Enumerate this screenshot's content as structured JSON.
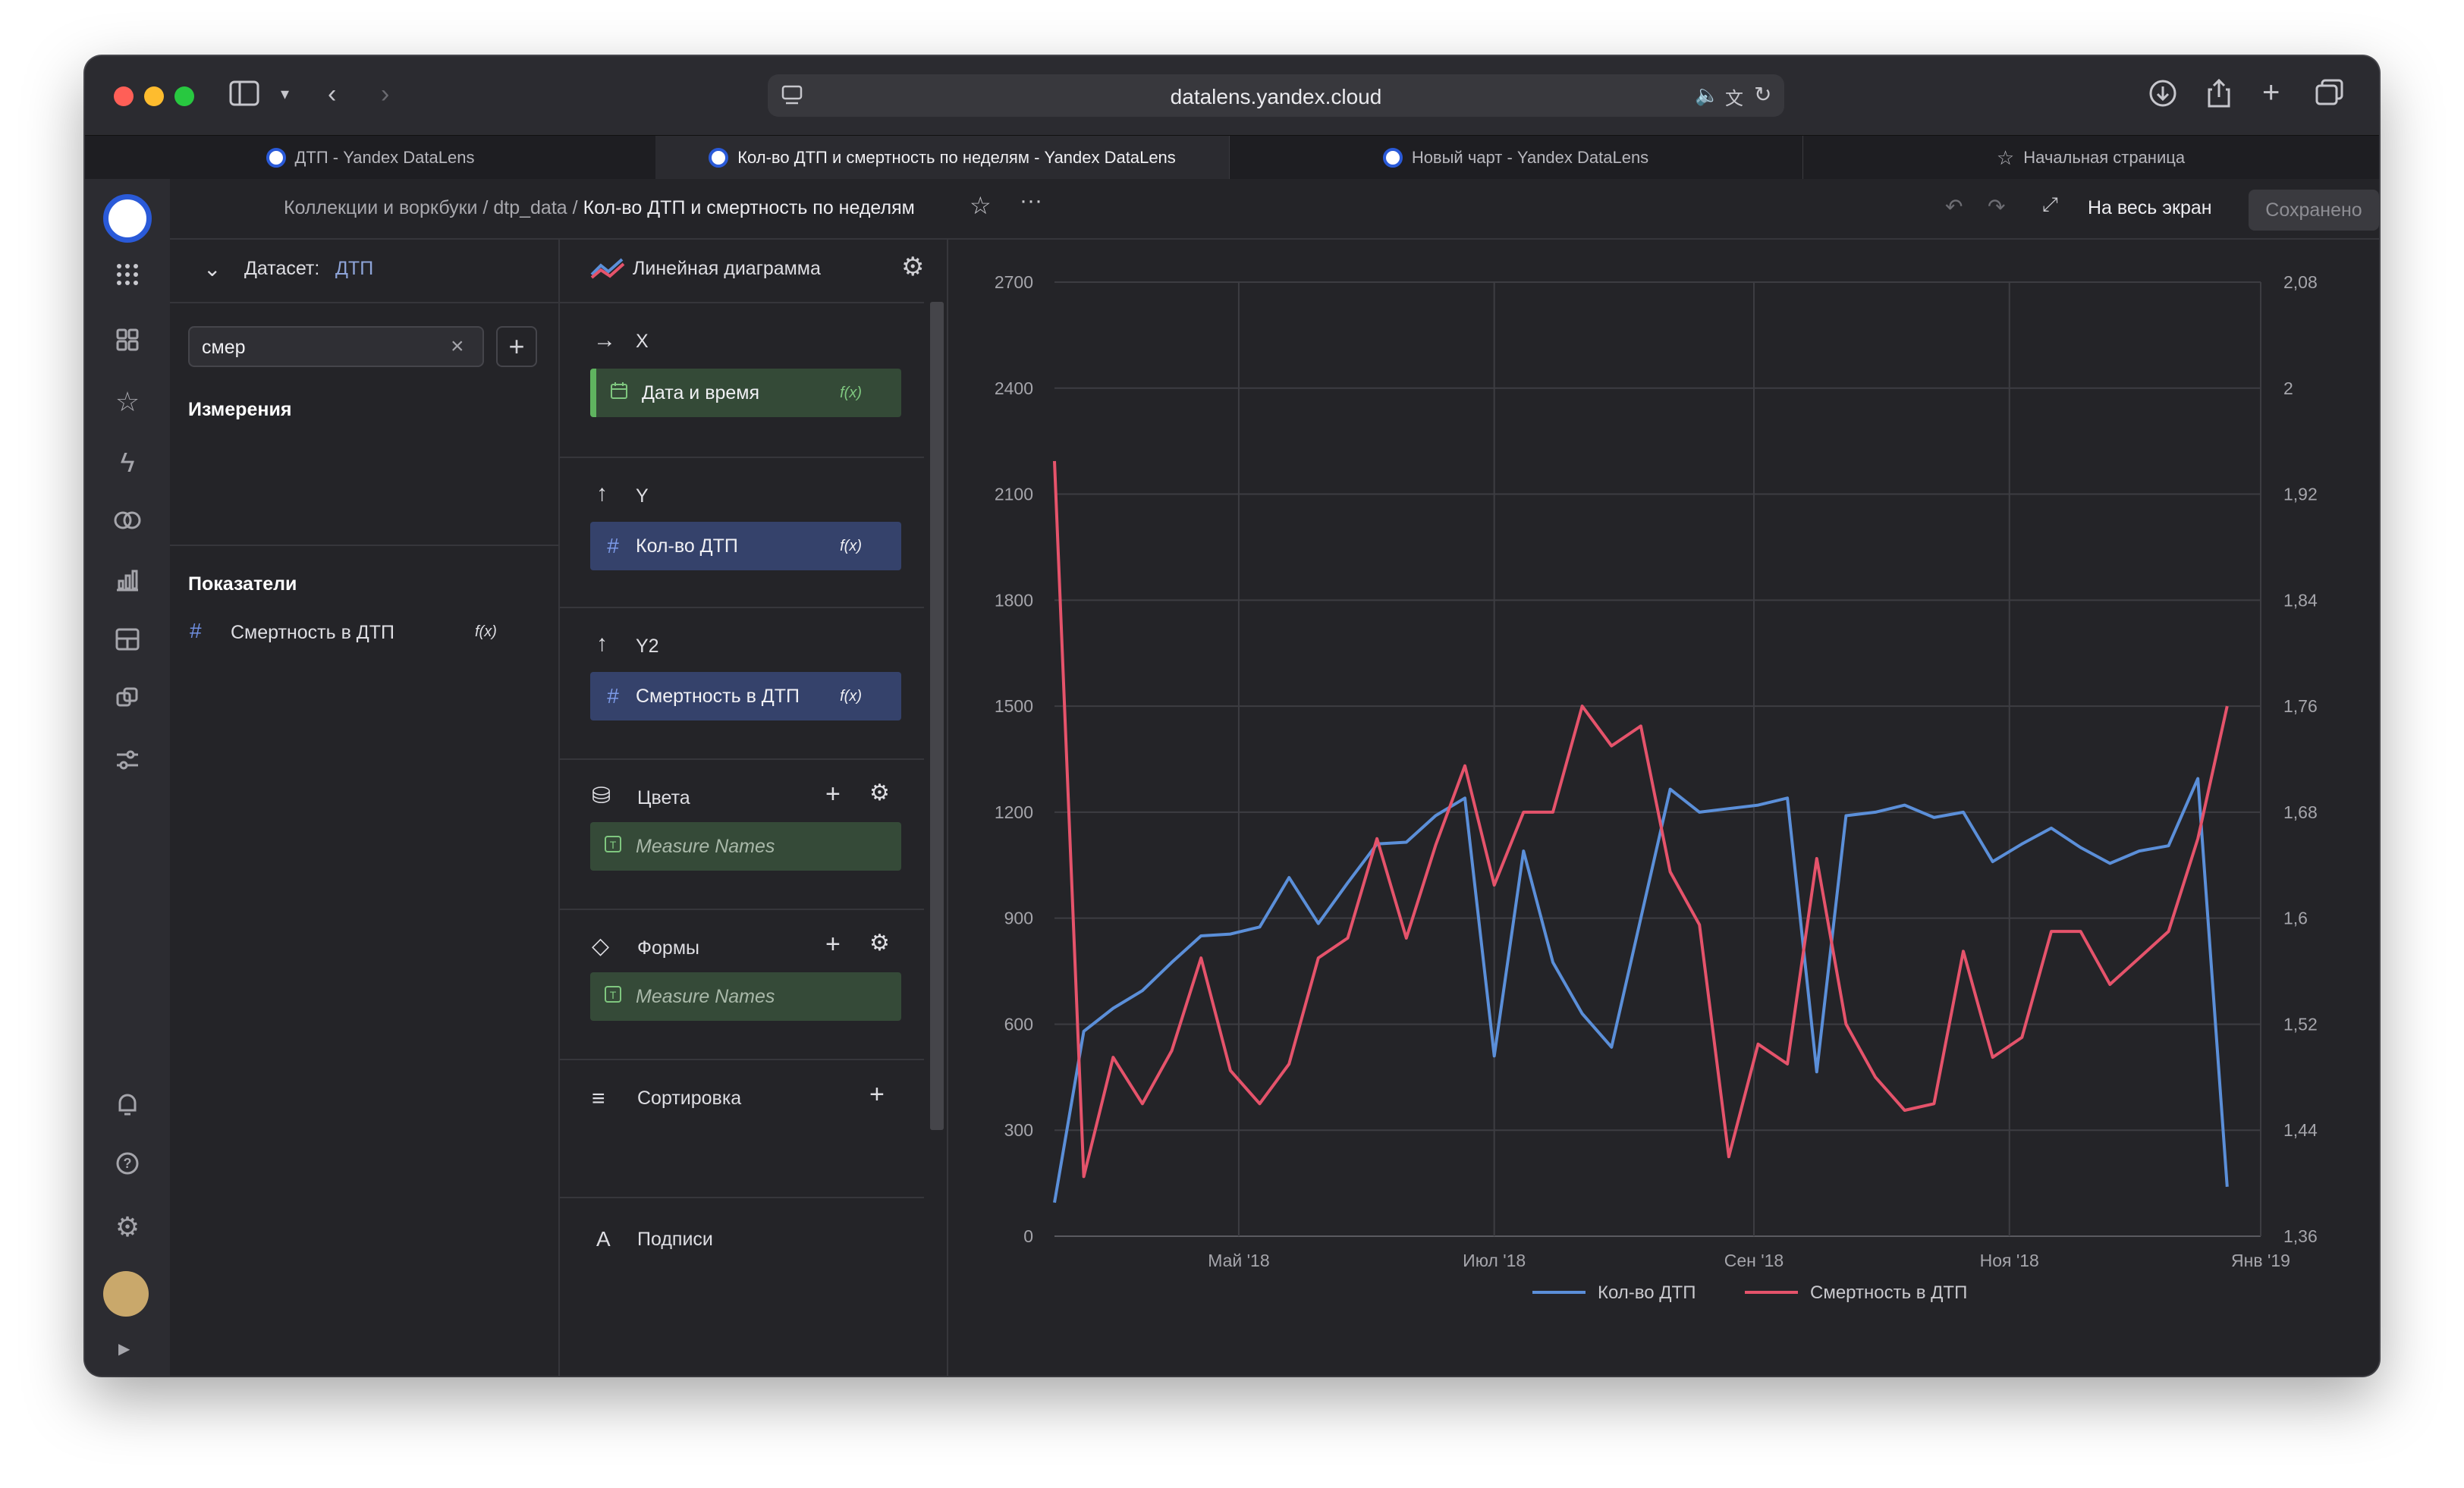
{
  "browser": {
    "url": "datalens.yandex.cloud",
    "tabs": [
      {
        "label": "ДТП - Yandex DataLens",
        "active": false
      },
      {
        "label": "Кол-во ДТП и смертность по неделям - Yandex DataLens",
        "active": true
      },
      {
        "label": "Новый чарт - Yandex DataLens",
        "active": false
      },
      {
        "label": "Начальная страница",
        "active": false
      }
    ]
  },
  "header": {
    "breadcrumbs": [
      "Коллекции и воркбуки",
      "dtp_data"
    ],
    "separator": "/",
    "title": "Кол-во ДТП и смертность по неделям",
    "fullscreen_label": "На весь экран",
    "saved_label": "Сохранено"
  },
  "dataset": {
    "label": "Датасет:",
    "name": "ДТП",
    "search_value": "смер",
    "dimensions_title": "Измерения",
    "measures_title": "Показатели",
    "measures": [
      {
        "label": "Смертность в ДТП",
        "fx": "f(x)"
      }
    ]
  },
  "visualization": {
    "type_label": "Линейная диаграмма",
    "sections": {
      "x": {
        "label": "X",
        "field": "Дата и время",
        "fx": "f(x)"
      },
      "y": {
        "label": "Y",
        "field": "Кол-во ДТП",
        "fx": "f(x)"
      },
      "y2": {
        "label": "Y2",
        "field": "Смертность в ДТП",
        "fx": "f(x)"
      },
      "colors": {
        "label": "Цвета",
        "field": "Measure Names"
      },
      "shapes": {
        "label": "Формы",
        "field": "Measure Names"
      },
      "sort": {
        "label": "Сортировка"
      },
      "labels": {
        "label": "Подписи"
      }
    }
  },
  "colors": {
    "accent": "#4e78e8",
    "series1": "#5b8fd9",
    "series2": "#e5536b"
  },
  "chart_data": {
    "type": "line",
    "x": [
      "2018-03-18",
      "2018-03-25",
      "2018-04-01",
      "2018-04-08",
      "2018-04-15",
      "2018-04-22",
      "2018-04-29",
      "2018-05-06",
      "2018-05-13",
      "2018-05-20",
      "2018-05-27",
      "2018-06-03",
      "2018-06-10",
      "2018-06-17",
      "2018-06-24",
      "2018-07-01",
      "2018-07-08",
      "2018-07-15",
      "2018-07-22",
      "2018-07-29",
      "2018-08-05",
      "2018-08-12",
      "2018-08-19",
      "2018-08-26",
      "2018-09-02",
      "2018-09-09",
      "2018-09-16",
      "2018-09-23",
      "2018-09-30",
      "2018-10-07",
      "2018-10-14",
      "2018-10-21",
      "2018-10-28",
      "2018-11-04",
      "2018-11-11",
      "2018-11-18",
      "2018-11-25",
      "2018-12-02",
      "2018-12-09",
      "2018-12-16",
      "2018-12-23",
      "2018-12-30"
    ],
    "series": [
      {
        "name": "Кол-во ДТП",
        "axis": "left",
        "color": "#5b8fd9",
        "values": [
          95,
          580,
          645,
          695,
          775,
          850,
          855,
          875,
          1015,
          885,
          1000,
          1110,
          1115,
          1190,
          1240,
          510,
          1090,
          775,
          630,
          535,
          900,
          1265,
          1200,
          1210,
          1220,
          1240,
          465,
          1190,
          1200,
          1220,
          1185,
          1200,
          1060,
          1110,
          1155,
          1100,
          1055,
          1090,
          1105,
          1295,
          140
        ]
      },
      {
        "name": "Смертность в ДТП",
        "axis": "right",
        "color": "#e5536b",
        "values": [
          1.945,
          1.405,
          1.495,
          1.46,
          1.5,
          1.57,
          1.485,
          1.46,
          1.49,
          1.57,
          1.585,
          1.66,
          1.585,
          1.655,
          1.715,
          1.625,
          1.68,
          1.68,
          1.76,
          1.73,
          1.745,
          1.635,
          1.595,
          1.42,
          1.505,
          1.49,
          1.645,
          1.52,
          1.48,
          1.455,
          1.46,
          1.575,
          1.495,
          1.51,
          1.59,
          1.59,
          1.55,
          1.57,
          1.59,
          1.66,
          1.76
        ]
      }
    ],
    "xticks": [
      {
        "at": "2018-05-01",
        "label": "Май '18"
      },
      {
        "at": "2018-07-01",
        "label": "Июл '18"
      },
      {
        "at": "2018-09-01",
        "label": "Сен '18"
      },
      {
        "at": "2018-11-01",
        "label": "Ноя '18"
      },
      {
        "at": "2018-12-31",
        "label": "Янв '19"
      }
    ],
    "yticks_left": [
      "0",
      "300",
      "600",
      "900",
      "1200",
      "1500",
      "1800",
      "2100",
      "2400",
      "2700"
    ],
    "ylim_left": [
      0,
      2700
    ],
    "yticks_right": [
      "1,36",
      "1,44",
      "1,52",
      "1,6",
      "1,68",
      "1,76",
      "1,84",
      "1,92",
      "2",
      "2,08"
    ],
    "ylim_right": [
      1.36,
      2.08
    ],
    "xlim": [
      "2018-03-18",
      "2018-12-31"
    ],
    "grid": true,
    "legend_position": "bottom"
  }
}
